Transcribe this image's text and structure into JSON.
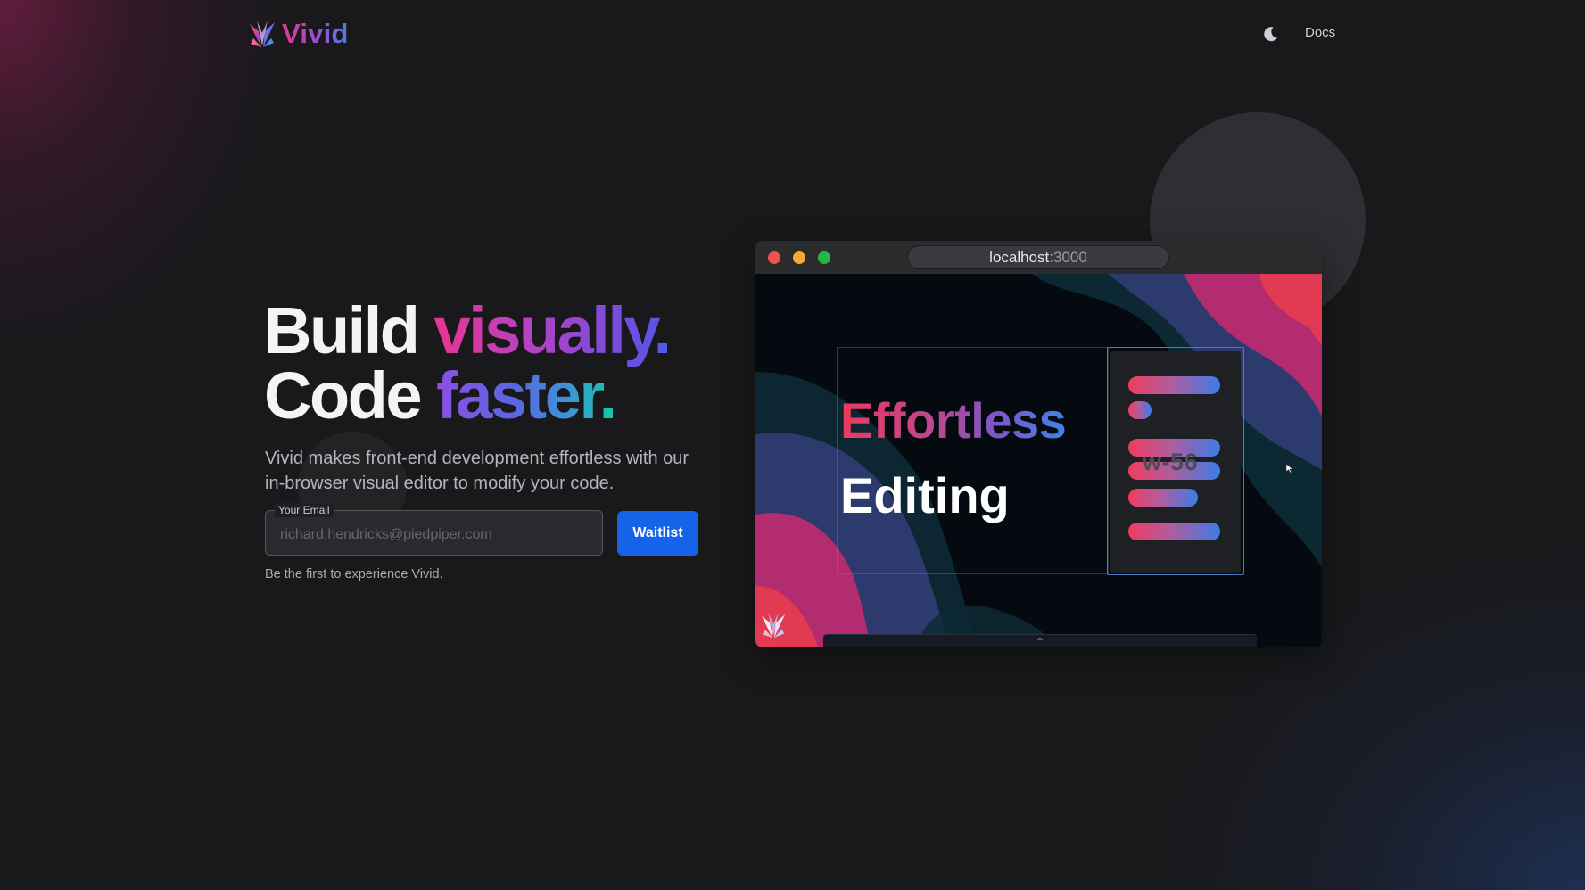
{
  "header": {
    "brand": "Vivid",
    "docs_label": "Docs",
    "theme_icon": "moon-icon"
  },
  "hero": {
    "line1_plain": "Build ",
    "line1_accent": "visually.",
    "line2_plain": "Code ",
    "line2_accent": "faster.",
    "subtitle": "Vivid makes front-end development effortless with our in-browser visual editor to modify your code.",
    "email_label": "Your Email",
    "email_placeholder": "richard.hendricks@piedpiper.com",
    "email_value": "",
    "waitlist_label": "Waitlist",
    "tagline": "Be the first to experience Vivid."
  },
  "browser": {
    "url_host": "localhost",
    "url_port": ":3000",
    "headline_1": "Effortless",
    "headline_2": "Editing",
    "class_label": "w-56",
    "drawer_toggle": "⌃"
  },
  "colors": {
    "background": "#19191c",
    "waitlist_button": "#1463e8",
    "brand_pink": "#e03a8a",
    "brand_blue": "#4a7ee6",
    "traffic_red": "#ee5249",
    "traffic_yellow": "#f2ac34",
    "traffic_green": "#1fba45"
  }
}
